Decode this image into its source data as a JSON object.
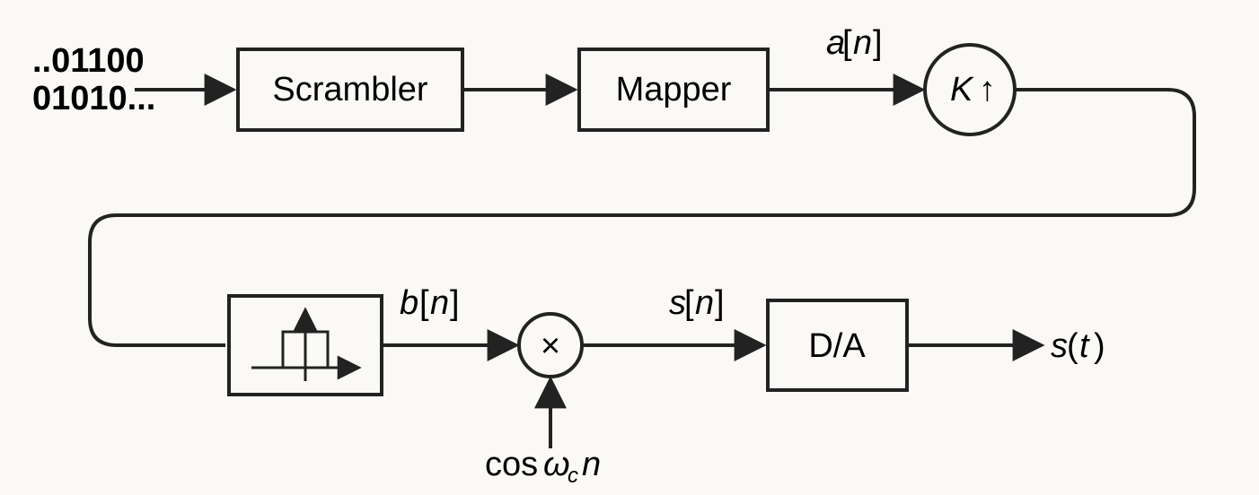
{
  "input_bits_line1": "..01100",
  "input_bits_line2": "01010...",
  "block_scrambler": "Scrambler",
  "block_mapper": "Mapper",
  "upsampler_K": "K",
  "upsampler_arrow": "↑",
  "signal_a": "a",
  "signal_a_idx": "n",
  "signal_b": "b",
  "signal_b_idx": "n",
  "signal_s": "s",
  "signal_s_idx": "n",
  "multiplier_symbol": "×",
  "carrier_cos": "cos",
  "carrier_omega": "ω",
  "carrier_sub": "c",
  "carrier_n": "n",
  "block_da": "D/A",
  "output_s": "s",
  "output_t": "t"
}
